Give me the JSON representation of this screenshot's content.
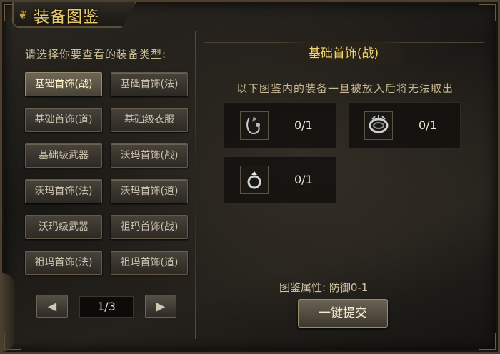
{
  "window": {
    "title": "装备图鉴"
  },
  "left": {
    "hint": "请选择你要查看的装备类型:",
    "categories": [
      "基础首饰(战)",
      "基础首饰(法)",
      "基础首饰(道)",
      "基础级衣服",
      "基础级武器",
      "沃玛首饰(战)",
      "沃玛首饰(法)",
      "沃玛首饰(道)",
      "沃玛级武器",
      "祖玛首饰(战)",
      "祖玛首饰(法)",
      "祖玛首饰(道)"
    ],
    "active_index": 0,
    "pager": {
      "prev": "◀",
      "page": "1/3",
      "next": "▶"
    }
  },
  "right": {
    "header": "基础首饰(战)",
    "note": "以下图鉴内的装备一旦被放入后将无法取出",
    "slots": [
      {
        "icon": "necklace-icon",
        "count": "0/1"
      },
      {
        "icon": "bracelet-icon",
        "count": "0/1"
      },
      {
        "icon": "ring-icon",
        "count": "0/1"
      }
    ],
    "attribute": "图鉴属性: 防御0-1",
    "submit_label": "一键提交"
  }
}
